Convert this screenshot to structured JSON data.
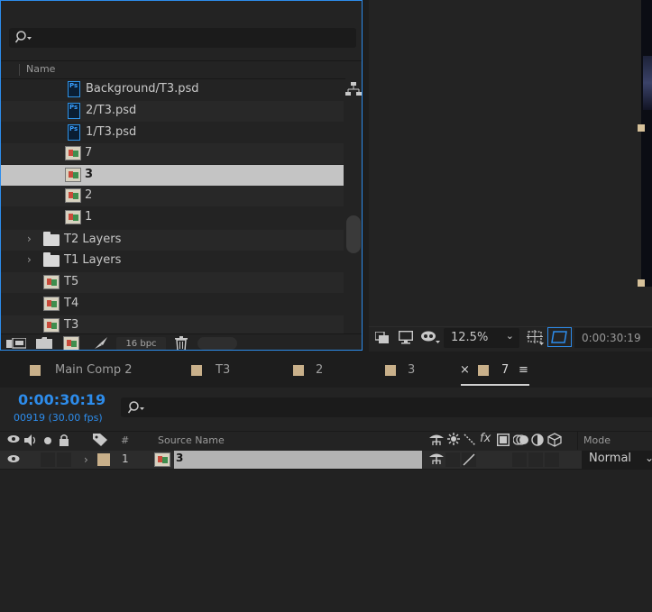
{
  "project": {
    "search_icon": "search-icon",
    "column_name": "Name",
    "items": [
      {
        "label": "Background/T3.psd",
        "type": "psd"
      },
      {
        "label": "2/T3.psd",
        "type": "psd"
      },
      {
        "label": "1/T3.psd",
        "type": "psd"
      },
      {
        "label": "7",
        "type": "comp"
      },
      {
        "label": "3",
        "type": "comp",
        "selected": true
      },
      {
        "label": "2",
        "type": "comp"
      },
      {
        "label": "1",
        "type": "comp"
      },
      {
        "label": "T2 Layers",
        "type": "folder"
      },
      {
        "label": "T1 Layers",
        "type": "folder"
      },
      {
        "label": "T5",
        "type": "comp"
      },
      {
        "label": "T4",
        "type": "comp"
      },
      {
        "label": "T3",
        "type": "comp"
      }
    ],
    "footer": {
      "bpc": "16 bpc"
    }
  },
  "viewer": {
    "zoom": "12.5%",
    "timecode": "0:00:30:19"
  },
  "timeline": {
    "tabs": [
      {
        "label": "Main Comp 2"
      },
      {
        "label": "T3"
      },
      {
        "label": "2"
      },
      {
        "label": "3"
      },
      {
        "label": "7",
        "active": true,
        "close": "×",
        "menu": "≡"
      }
    ],
    "timecode": "0:00:30:19",
    "frame_info": "00919 (30.00 fps)",
    "headers": {
      "number": "#",
      "source_name": "Source Name",
      "mode": "Mode"
    },
    "layer": {
      "number": "1",
      "name": "3",
      "mode": "Normal"
    }
  },
  "colors": {
    "accent": "#2d8ceb",
    "label_swatch": "#c9b08a",
    "selection": "#c4c4c4"
  }
}
